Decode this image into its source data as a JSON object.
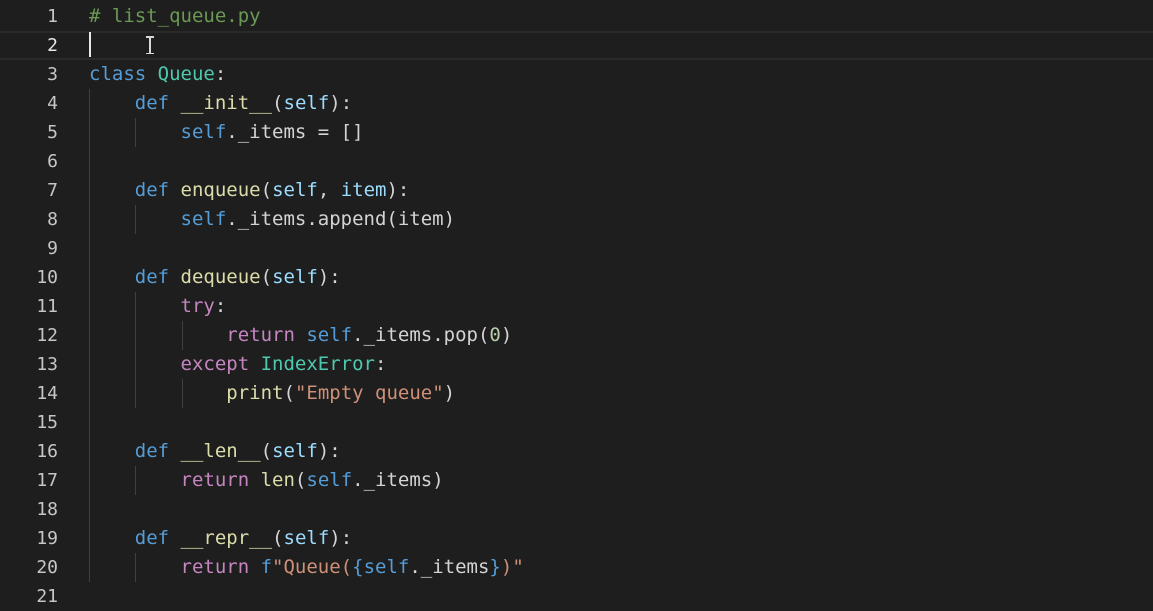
{
  "editor": {
    "language": "python",
    "current_line": 2,
    "colors": {
      "background": "#1e1e1e",
      "line_number": "#c6c6c6",
      "comment": "#6a9955",
      "keyword": "#569cd6",
      "control_keyword": "#c586c0",
      "class_name": "#4ec9b0",
      "function": "#dcdcaa",
      "parameter": "#9cdcfe",
      "string": "#ce9178",
      "number": "#b5cea8",
      "plain": "#d4d4d4"
    },
    "cursor_icon": "text-ibeam-icon",
    "lines": [
      {
        "number": "1",
        "tokens": [
          {
            "t": "# list_queue.py",
            "k": "comment"
          }
        ]
      },
      {
        "number": "2",
        "tokens": []
      },
      {
        "number": "3",
        "tokens": [
          {
            "t": "class ",
            "k": "kw"
          },
          {
            "t": "Queue",
            "k": "class"
          },
          {
            "t": ":",
            "k": "plain"
          }
        ]
      },
      {
        "number": "4",
        "tokens": [
          {
            "t": "    ",
            "k": "plain"
          },
          {
            "t": "def ",
            "k": "kw"
          },
          {
            "t": "__init__",
            "k": "func"
          },
          {
            "t": "(",
            "k": "plain"
          },
          {
            "t": "self",
            "k": "param"
          },
          {
            "t": "):",
            "k": "plain"
          }
        ]
      },
      {
        "number": "5",
        "tokens": [
          {
            "t": "        ",
            "k": "plain"
          },
          {
            "t": "self",
            "k": "self"
          },
          {
            "t": "._items = []",
            "k": "plain"
          }
        ]
      },
      {
        "number": "6",
        "tokens": []
      },
      {
        "number": "7",
        "tokens": [
          {
            "t": "    ",
            "k": "plain"
          },
          {
            "t": "def ",
            "k": "kw"
          },
          {
            "t": "enqueue",
            "k": "func"
          },
          {
            "t": "(",
            "k": "plain"
          },
          {
            "t": "self",
            "k": "param"
          },
          {
            "t": ", ",
            "k": "plain"
          },
          {
            "t": "item",
            "k": "param"
          },
          {
            "t": "):",
            "k": "plain"
          }
        ]
      },
      {
        "number": "8",
        "tokens": [
          {
            "t": "        ",
            "k": "plain"
          },
          {
            "t": "self",
            "k": "self"
          },
          {
            "t": "._items.append(item)",
            "k": "plain"
          }
        ]
      },
      {
        "number": "9",
        "tokens": []
      },
      {
        "number": "10",
        "tokens": [
          {
            "t": "    ",
            "k": "plain"
          },
          {
            "t": "def ",
            "k": "kw"
          },
          {
            "t": "dequeue",
            "k": "func"
          },
          {
            "t": "(",
            "k": "plain"
          },
          {
            "t": "self",
            "k": "param"
          },
          {
            "t": "):",
            "k": "plain"
          }
        ]
      },
      {
        "number": "11",
        "tokens": [
          {
            "t": "        ",
            "k": "plain"
          },
          {
            "t": "try",
            "k": "ctrl"
          },
          {
            "t": ":",
            "k": "plain"
          }
        ]
      },
      {
        "number": "12",
        "tokens": [
          {
            "t": "            ",
            "k": "plain"
          },
          {
            "t": "return ",
            "k": "ctrl"
          },
          {
            "t": "self",
            "k": "self"
          },
          {
            "t": "._items.pop(",
            "k": "plain"
          },
          {
            "t": "0",
            "k": "number"
          },
          {
            "t": ")",
            "k": "plain"
          }
        ]
      },
      {
        "number": "13",
        "tokens": [
          {
            "t": "        ",
            "k": "plain"
          },
          {
            "t": "except ",
            "k": "ctrl"
          },
          {
            "t": "IndexError",
            "k": "class"
          },
          {
            "t": ":",
            "k": "plain"
          }
        ]
      },
      {
        "number": "14",
        "tokens": [
          {
            "t": "            ",
            "k": "plain"
          },
          {
            "t": "print",
            "k": "builtin"
          },
          {
            "t": "(",
            "k": "plain"
          },
          {
            "t": "\"Empty queue\"",
            "k": "string"
          },
          {
            "t": ")",
            "k": "plain"
          }
        ]
      },
      {
        "number": "15",
        "tokens": []
      },
      {
        "number": "16",
        "tokens": [
          {
            "t": "    ",
            "k": "plain"
          },
          {
            "t": "def ",
            "k": "kw"
          },
          {
            "t": "__len__",
            "k": "func"
          },
          {
            "t": "(",
            "k": "plain"
          },
          {
            "t": "self",
            "k": "param"
          },
          {
            "t": "):",
            "k": "plain"
          }
        ]
      },
      {
        "number": "17",
        "tokens": [
          {
            "t": "        ",
            "k": "plain"
          },
          {
            "t": "return ",
            "k": "ctrl"
          },
          {
            "t": "len",
            "k": "builtin"
          },
          {
            "t": "(",
            "k": "plain"
          },
          {
            "t": "self",
            "k": "self"
          },
          {
            "t": "._items)",
            "k": "plain"
          }
        ]
      },
      {
        "number": "18",
        "tokens": []
      },
      {
        "number": "19",
        "tokens": [
          {
            "t": "    ",
            "k": "plain"
          },
          {
            "t": "def ",
            "k": "kw"
          },
          {
            "t": "__repr__",
            "k": "func"
          },
          {
            "t": "(",
            "k": "plain"
          },
          {
            "t": "self",
            "k": "param"
          },
          {
            "t": "):",
            "k": "plain"
          }
        ]
      },
      {
        "number": "20",
        "tokens": [
          {
            "t": "        ",
            "k": "plain"
          },
          {
            "t": "return ",
            "k": "ctrl"
          },
          {
            "t": "f",
            "k": "kw"
          },
          {
            "t": "\"Queue(",
            "k": "string"
          },
          {
            "t": "{",
            "k": "kw"
          },
          {
            "t": "self",
            "k": "self"
          },
          {
            "t": "._items",
            "k": "plain"
          },
          {
            "t": "}",
            "k": "kw"
          },
          {
            "t": ")\"",
            "k": "string"
          }
        ]
      },
      {
        "number": "21",
        "tokens": []
      }
    ]
  }
}
